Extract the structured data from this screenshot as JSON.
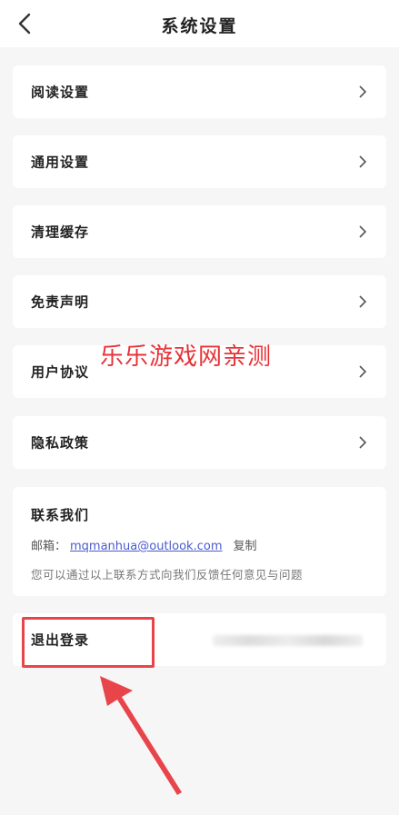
{
  "header": {
    "title": "系统设置"
  },
  "menu": [
    {
      "label": "阅读设置"
    },
    {
      "label": "通用设置"
    },
    {
      "label": "清理缓存"
    },
    {
      "label": "免责声明"
    },
    {
      "label": "用户协议"
    },
    {
      "label": "隐私政策"
    }
  ],
  "contact": {
    "title": "联系我们",
    "email_label": "邮箱：",
    "email": "mqmanhua@outlook.com",
    "copy_label": "复制",
    "note": "您可以通过以上联系方式向我们反馈任何意见与问题"
  },
  "logout": {
    "label": "退出登录"
  },
  "overlay": {
    "watermark": "乐乐游戏网亲测"
  },
  "colors": {
    "accent_red": "#e8454b",
    "link": "#4a5bcf",
    "background": "#f6f6f7"
  }
}
